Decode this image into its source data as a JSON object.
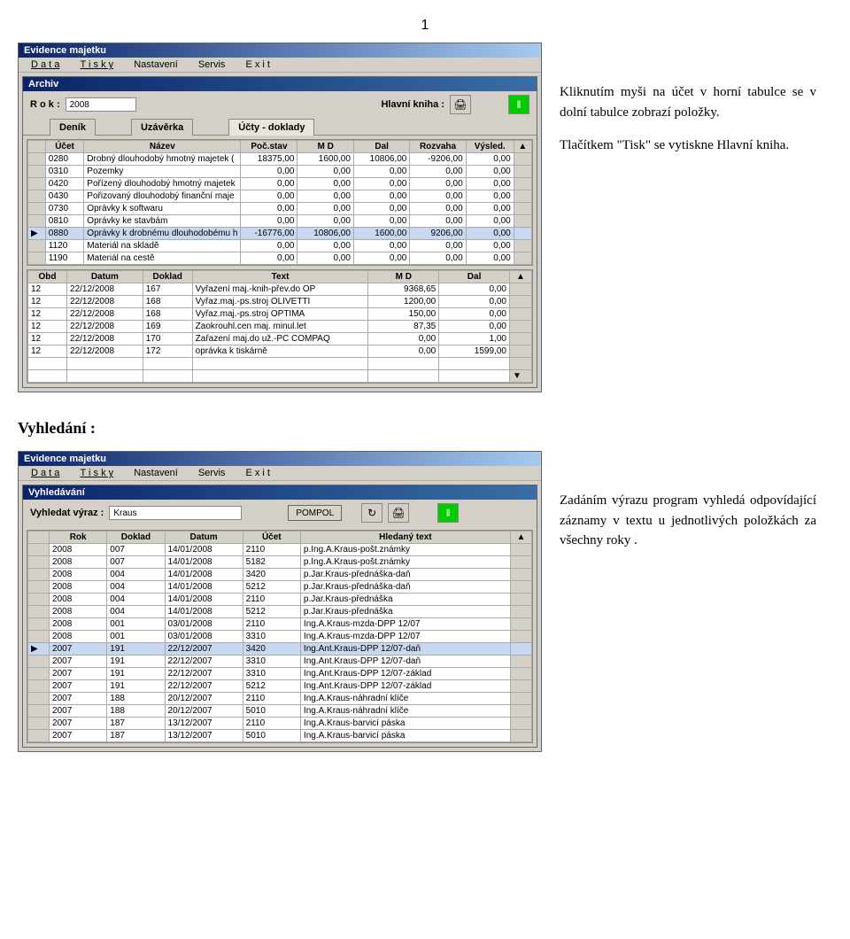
{
  "page_number": "1",
  "desc1": {
    "p1": "Kliknutím myši na účet v horní tabulce se v dolní tabulce zobrazí položky.",
    "p2": "Tlačítkem \"Tisk\" se vytiskne Hlavní kniha."
  },
  "section2_heading": "Vyhledání :",
  "desc2": {
    "p1": "Zadáním výrazu program vyhledá odpovídající záznamy v textu u jednotlivých položkách za všechny roky ."
  },
  "app_title": "Evidence majetku",
  "menu": {
    "m1": "D a t a",
    "m2": "T i s k y",
    "m3": "Nastavení",
    "m4": "Servis",
    "m5": "E x i t"
  },
  "win1": {
    "title": "Archiv",
    "rok_label": "R o k :",
    "rok_value": "2008",
    "hlavni_label": "Hlavní kniha :",
    "tab1": "Deník",
    "tab2": "Uzávěrka",
    "tab3": "Účty - doklady",
    "top_headers": {
      "h1": "Účet",
      "h2": "Název",
      "h3": "Poč.stav",
      "h4": "M D",
      "h5": "Dal",
      "h6": "Rozvaha",
      "h7": "Výsled."
    },
    "top_rows": [
      {
        "ucet": "0280",
        "nazev": "Drobný dlouhodobý hmotný majetek (",
        "poc": "18375,00",
        "md": "1600,00",
        "dal": "10806,00",
        "roz": "-9206,00",
        "vys": "0,00"
      },
      {
        "ucet": "0310",
        "nazev": "Pozemky",
        "poc": "0,00",
        "md": "0,00",
        "dal": "0,00",
        "roz": "0,00",
        "vys": "0,00"
      },
      {
        "ucet": "0420",
        "nazev": "Pořízený dlouhodobý hmotný majetek",
        "poc": "0,00",
        "md": "0,00",
        "dal": "0,00",
        "roz": "0,00",
        "vys": "0,00"
      },
      {
        "ucet": "0430",
        "nazev": "Pořizovaný dlouhodobý finanční maje",
        "poc": "0,00",
        "md": "0,00",
        "dal": "0,00",
        "roz": "0,00",
        "vys": "0,00"
      },
      {
        "ucet": "0730",
        "nazev": "Oprávky k softwaru",
        "poc": "0,00",
        "md": "0,00",
        "dal": "0,00",
        "roz": "0,00",
        "vys": "0,00"
      },
      {
        "ucet": "0810",
        "nazev": "Oprávky ke stavbám",
        "poc": "0,00",
        "md": "0,00",
        "dal": "0,00",
        "roz": "0,00",
        "vys": "0,00"
      },
      {
        "ucet": "0880",
        "nazev": "Oprávky k drobnému dlouhodobému h",
        "poc": "-16776,00",
        "md": "10806,00",
        "dal": "1600,00",
        "roz": "9206,00",
        "vys": "0,00",
        "sel": true
      },
      {
        "ucet": "1120",
        "nazev": "Materiál na skladě",
        "poc": "0,00",
        "md": "0,00",
        "dal": "0,00",
        "roz": "0,00",
        "vys": "0,00"
      },
      {
        "ucet": "1190",
        "nazev": "Materiál na cestě",
        "poc": "0,00",
        "md": "0,00",
        "dal": "0,00",
        "roz": "0,00",
        "vys": "0,00"
      }
    ],
    "bot_headers": {
      "h1": "Obd",
      "h2": "Datum",
      "h3": "Doklad",
      "h4": "Text",
      "h5": "M D",
      "h6": "Dal"
    },
    "bot_rows": [
      {
        "obd": "12",
        "dat": "22/12/2008",
        "dok": "167",
        "txt": "Vyřazení maj.-knih-přev.do OP",
        "md": "9368,65",
        "dal": "0,00"
      },
      {
        "obd": "12",
        "dat": "22/12/2008",
        "dok": "168",
        "txt": "Vyřaz.maj.-ps.stroj OLIVETTI",
        "md": "1200,00",
        "dal": "0,00"
      },
      {
        "obd": "12",
        "dat": "22/12/2008",
        "dok": "168",
        "txt": "Vyřaz.maj.-ps.stroj OPTIMA",
        "md": "150,00",
        "dal": "0,00"
      },
      {
        "obd": "12",
        "dat": "22/12/2008",
        "dok": "169",
        "txt": "Zaokrouhl.cen maj. minul.let",
        "md": "87,35",
        "dal": "0,00"
      },
      {
        "obd": "12",
        "dat": "22/12/2008",
        "dok": "170",
        "txt": "Zařazení maj.do už.-PC COMPAQ",
        "md": "0,00",
        "dal": "1,00"
      },
      {
        "obd": "12",
        "dat": "22/12/2008",
        "dok": "172",
        "txt": "oprávka k tiskárně",
        "md": "0,00",
        "dal": "1599,00"
      }
    ]
  },
  "win2": {
    "title": "Vyhledávání",
    "search_label": "Vyhledat výraz :",
    "search_value": "Kraus",
    "btn_pompol": "POMPOL",
    "headers": {
      "h1": "Rok",
      "h2": "Doklad",
      "h3": "Datum",
      "h4": "Účet",
      "h5": "Hledaný text"
    },
    "rows": [
      {
        "rok": "2008",
        "dok": "007",
        "dat": "14/01/2008",
        "uc": "2110",
        "txt": "p.Ing.A.Kraus-pošt.známky"
      },
      {
        "rok": "2008",
        "dok": "007",
        "dat": "14/01/2008",
        "uc": "5182",
        "txt": "p.Ing.A.Kraus-pošt.známky"
      },
      {
        "rok": "2008",
        "dok": "004",
        "dat": "14/01/2008",
        "uc": "3420",
        "txt": "p.Jar.Kraus-přednáška-daň"
      },
      {
        "rok": "2008",
        "dok": "004",
        "dat": "14/01/2008",
        "uc": "5212",
        "txt": "p.Jar.Kraus-přednáška-daň"
      },
      {
        "rok": "2008",
        "dok": "004",
        "dat": "14/01/2008",
        "uc": "2110",
        "txt": "p.Jar.Kraus-přednáška"
      },
      {
        "rok": "2008",
        "dok": "004",
        "dat": "14/01/2008",
        "uc": "5212",
        "txt": "p.Jar.Kraus-přednáška"
      },
      {
        "rok": "2008",
        "dok": "001",
        "dat": "03/01/2008",
        "uc": "2110",
        "txt": "Ing.A.Kraus-mzda-DPP 12/07"
      },
      {
        "rok": "2008",
        "dok": "001",
        "dat": "03/01/2008",
        "uc": "3310",
        "txt": "Ing.A.Kraus-mzda-DPP 12/07"
      },
      {
        "rok": "2007",
        "dok": "191",
        "dat": "22/12/2007",
        "uc": "3420",
        "txt": "Ing.Ant.Kraus-DPP 12/07-daň",
        "sel": true
      },
      {
        "rok": "2007",
        "dok": "191",
        "dat": "22/12/2007",
        "uc": "3310",
        "txt": "Ing.Ant.Kraus-DPP 12/07-daň"
      },
      {
        "rok": "2007",
        "dok": "191",
        "dat": "22/12/2007",
        "uc": "3310",
        "txt": "Ing.Ant.Kraus-DPP 12/07-základ"
      },
      {
        "rok": "2007",
        "dok": "191",
        "dat": "22/12/2007",
        "uc": "5212",
        "txt": "Ing.Ant.Kraus-DPP 12/07-základ"
      },
      {
        "rok": "2007",
        "dok": "188",
        "dat": "20/12/2007",
        "uc": "2110",
        "txt": "Ing.A.Kraus-náhradní klíče"
      },
      {
        "rok": "2007",
        "dok": "188",
        "dat": "20/12/2007",
        "uc": "5010",
        "txt": "Ing.A.Kraus-náhradní klíče"
      },
      {
        "rok": "2007",
        "dok": "187",
        "dat": "13/12/2007",
        "uc": "2110",
        "txt": "Ing.A.Kraus-barvicí páska"
      },
      {
        "rok": "2007",
        "dok": "187",
        "dat": "13/12/2007",
        "uc": "5010",
        "txt": "Ing.A.Kraus-barvicí páska"
      }
    ]
  }
}
